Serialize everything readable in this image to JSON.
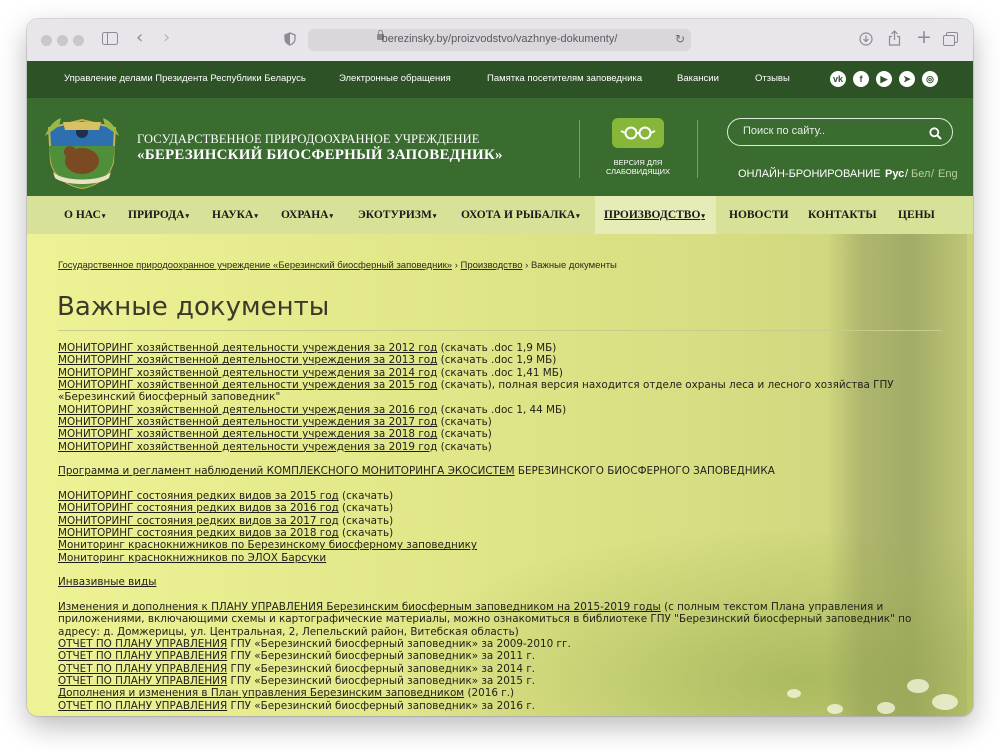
{
  "browser": {
    "url": "berezinsky.by/proizvodstvo/vazhnye-dokumenty/"
  },
  "topbar": {
    "links": [
      "Управление делами Президента Республики Беларусь",
      "Электронные обращения",
      "Памятка посетителям заповедника",
      "Вакансии",
      "Отзывы"
    ],
    "social_icons": [
      "vk-icon",
      "facebook-icon",
      "youtube-icon",
      "telegram-icon",
      "instagram-icon"
    ]
  },
  "header": {
    "org_line1": "ГОСУДАРСТВЕННОЕ ПРИРОДООХРАННОЕ УЧРЕЖДЕНИЕ",
    "org_line2": "«БЕРЕЗИНСКИЙ БИОСФЕРНЫЙ ЗАПОВЕДНИК»",
    "vision_label_1": "ВЕРСИЯ ДЛЯ",
    "vision_label_2": "СЛАБОВИДЯЩИХ",
    "search_placeholder": "Поиск по сайту..",
    "booking": "ОНЛАЙН-БРОНИРОВАНИЕ",
    "languages": [
      "Рус",
      "Бел",
      "Eng"
    ],
    "active_language": "Рус"
  },
  "menu": {
    "items": [
      "О НАС",
      "ПРИРОДА",
      "НАУКА",
      "ОХРАНА",
      "ЭКОТУРИЗМ",
      "ОХОТА И РЫБАЛКА",
      "ПРОИЗВОДСТВО",
      "НОВОСТИ",
      "КОНТАКТЫ",
      "ЦЕНЫ"
    ],
    "active": "ПРОИЗВОДСТВО"
  },
  "breadcrumb": {
    "home": "Государственное природоохранное учреждение «Березинский биосферный заповедник»",
    "section": "Производство",
    "current": "Важные документы"
  },
  "page": {
    "title": "Важные документы"
  },
  "documents": {
    "mon_group": [
      {
        "link": "МОНИТОРИНГ хозяйственной деятельности учреждения за 2012 год",
        "note": " (скачать .doc 1,9 МБ)"
      },
      {
        "link": "МОНИТОРИНГ хозяйственной деятельности учреждения за 2013 год",
        "note": " (скачать .doc 1,9 МБ)"
      },
      {
        "link": "МОНИТОРИНГ хозяйственной деятельности учреждения за 2014 год",
        "note": " (скачать .doc  1,41 МБ)"
      },
      {
        "link": "МОНИТОРИНГ хозяйственной деятельности учреждения за 2015 год",
        "note": " (скачать), полная версия находится отделе охраны леса и лесного хозяйства ГПУ «Березинский биосферный заповедник\""
      },
      {
        "link": "МОНИТОРИНГ хозяйственной деятельности учреждения за 2016 год",
        "note": " (скачать .doc 1, 44 МБ)"
      },
      {
        "link": "МОНИТОРИНГ хозяйственной деятельности учреждения за 2017 год",
        "note": " (скачать)"
      },
      {
        "link": "МОНИТОРИНГ хозяйственной деятельности учреждения за 2018 год",
        "note": " (скачать)"
      },
      {
        "link": "МОНИТОРИНГ хозяйственной деятельности учреждения за 2019 год",
        "note": " (скачать)"
      }
    ],
    "program": {
      "link": "Программа и регламент наблюдений КОМПЛЕКСНОГО МОНИТОРИНГА ЭКОСИСТЕМ",
      "note": " БЕРЕЗИНСКОГО БИОСФЕРНОГО ЗАПОВЕДНИКА"
    },
    "species_group": [
      {
        "link": "МОНИТОРИНГ состояния редких видов за 2015 год",
        "note": " (скачать)"
      },
      {
        "link": "МОНИТОРИНГ состояния редких видов за 2016 год",
        "note": " (скачать)"
      },
      {
        "link": "МОНИТОРИНГ состояния редких видов за 2017 год",
        "note": " (скачать)"
      },
      {
        "link": "МОНИТОРИНГ состояния редких видов за 2018 год",
        "note": " (скачать)"
      },
      {
        "link": "Мониторинг краснокнижников по Березинскому биосферному заповеднику",
        "note": ""
      },
      {
        "link": "Мониторинг краснокнижников по ЭЛОХ Барсуки",
        "note": ""
      }
    ],
    "invasive": "Инвазивные виды",
    "plan_group": [
      {
        "link": "Изменения и дополнения к ПЛАНУ УПРАВЛЕНИЯ Березинским биосферным заповедником на 2015-2019 годы",
        "note": " (с полным текстом Плана управления и приложениями, включающими схемы и картографические материалы, можно ознакомиться в библиотеке ГПУ \"Березинский биосферный заповедник\" по адресу: д. Домжерицы, ул. Центральная, 2, Лепельский район, Витебская область)"
      },
      {
        "link": "ОТЧЕТ ПО ПЛАНУ УПРАВЛЕНИЯ",
        "note": " ГПУ «Березинский биосферный заповедник» за 2009-2010 гг."
      },
      {
        "link": "ОТЧЕТ ПО ПЛАНУ УПРАВЛЕНИЯ",
        "note": " ГПУ «Березинский биосферный заповедник» за 2011 г."
      },
      {
        "link": "ОТЧЕТ ПО ПЛАНУ УПРАВЛЕНИЯ",
        "note": " ГПУ «Березинский биосферный заповедник» за 2014 г."
      },
      {
        "link": "ОТЧЕТ ПО ПЛАНУ УПРАВЛЕНИЯ",
        "note": " ГПУ «Березинский биосферный заповедник» за 2015 г."
      },
      {
        "link": "Дополнения и изменения в План управления Березинским заповедником",
        "note": " (2016 г.)"
      },
      {
        "link": "ОТЧЕТ ПО ПЛАНУ УПРАВЛЕНИЯ",
        "note": " ГПУ «Березинский биосферный заповедник» за 2016 г."
      }
    ]
  }
}
